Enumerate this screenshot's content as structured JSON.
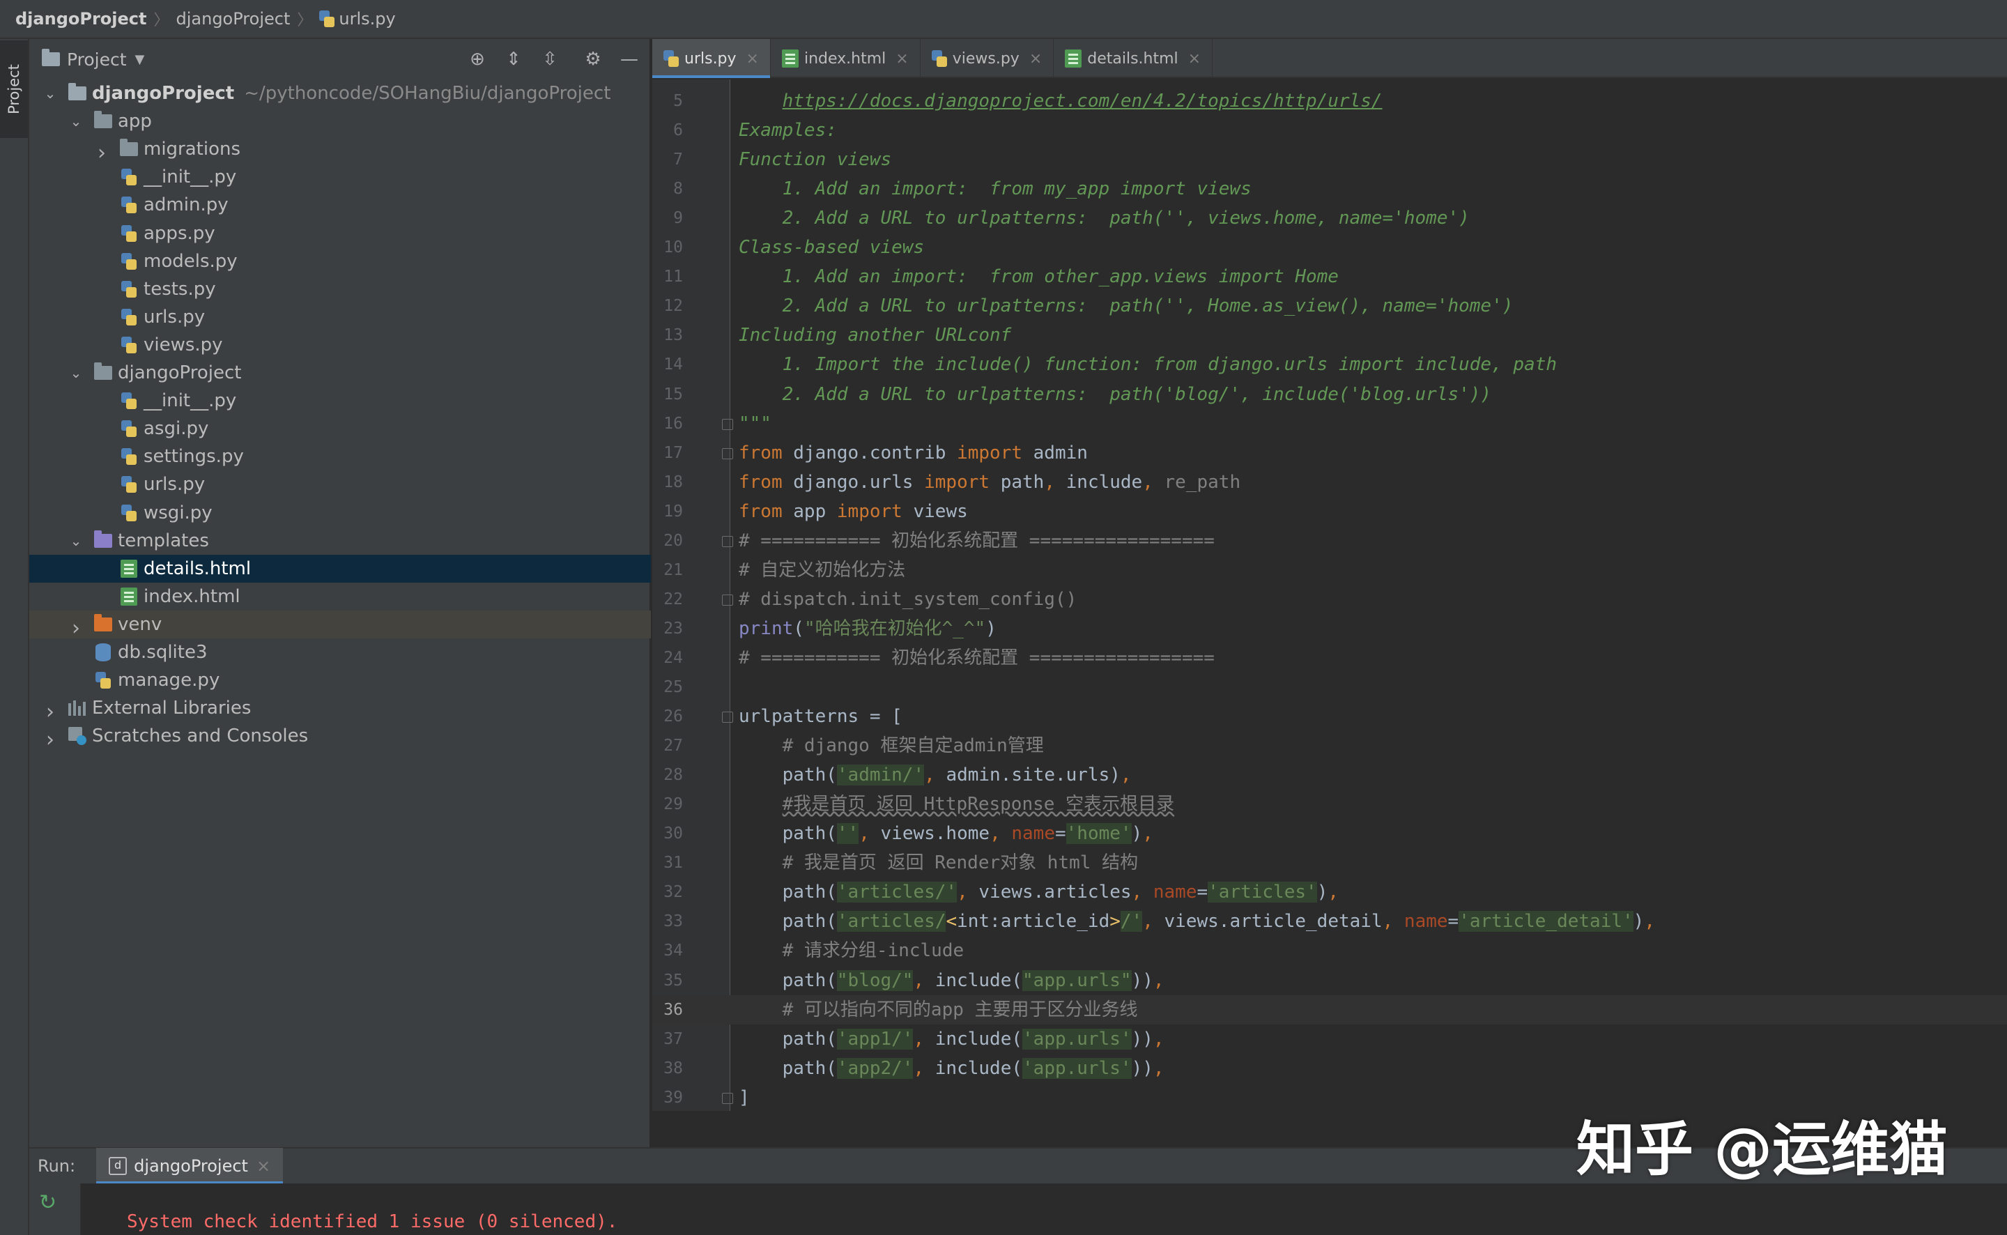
{
  "breadcrumb": [
    "djangoProject",
    "djangoProject",
    "urls.py"
  ],
  "stripe": {
    "project_label": "Project"
  },
  "project_panel": {
    "title": "Project",
    "icons": [
      "locate-icon",
      "expand-all-icon",
      "collapse-all-icon",
      "settings-gear-icon",
      "hide-minus-icon"
    ],
    "tree": [
      {
        "label": "djangoProject",
        "path": "~/pythoncode/SOHangBiu/djangoProject",
        "type": "root",
        "depth": 0,
        "expanded": true
      },
      {
        "label": "app",
        "type": "folder",
        "depth": 1,
        "expanded": true
      },
      {
        "label": "migrations",
        "type": "folder",
        "depth": 2,
        "expanded": false
      },
      {
        "label": "__init__.py",
        "type": "py",
        "depth": 2
      },
      {
        "label": "admin.py",
        "type": "py",
        "depth": 2
      },
      {
        "label": "apps.py",
        "type": "py",
        "depth": 2
      },
      {
        "label": "models.py",
        "type": "py",
        "depth": 2
      },
      {
        "label": "tests.py",
        "type": "py",
        "depth": 2
      },
      {
        "label": "urls.py",
        "type": "py",
        "depth": 2
      },
      {
        "label": "views.py",
        "type": "py",
        "depth": 2
      },
      {
        "label": "djangoProject",
        "type": "folder",
        "depth": 1,
        "expanded": true
      },
      {
        "label": "__init__.py",
        "type": "py",
        "depth": 2
      },
      {
        "label": "asgi.py",
        "type": "py",
        "depth": 2
      },
      {
        "label": "settings.py",
        "type": "py",
        "depth": 2
      },
      {
        "label": "urls.py",
        "type": "py",
        "depth": 2
      },
      {
        "label": "wsgi.py",
        "type": "py",
        "depth": 2
      },
      {
        "label": "templates",
        "type": "folder-purple",
        "depth": 1,
        "expanded": true
      },
      {
        "label": "details.html",
        "type": "html",
        "depth": 2,
        "selected": true
      },
      {
        "label": "index.html",
        "type": "html",
        "depth": 2
      },
      {
        "label": "venv",
        "type": "folder-orange",
        "depth": 1,
        "expanded": false,
        "highlight": true
      },
      {
        "label": "db.sqlite3",
        "type": "db",
        "depth": 1
      },
      {
        "label": "manage.py",
        "type": "py",
        "depth": 1
      },
      {
        "label": "External Libraries",
        "type": "lib",
        "depth": 0,
        "expanded": false
      },
      {
        "label": "Scratches and Consoles",
        "type": "scratch",
        "depth": 0,
        "expanded": false
      }
    ]
  },
  "editor_tabs": [
    {
      "label": "urls.py",
      "type": "py",
      "active": true
    },
    {
      "label": "index.html",
      "type": "html",
      "active": false
    },
    {
      "label": "views.py",
      "type": "py",
      "active": false
    },
    {
      "label": "details.html",
      "type": "html",
      "active": false
    }
  ],
  "editor": {
    "current_line": 36,
    "lines": [
      {
        "n": "5",
        "tokens": [
          [
            "    ",
            "c-doc"
          ],
          [
            "https://docs.djangoproject.com/en/4.2/topics/http/urls/",
            "c-link"
          ]
        ]
      },
      {
        "n": "6",
        "tokens": [
          [
            "Examples:",
            "c-doc"
          ]
        ]
      },
      {
        "n": "7",
        "tokens": [
          [
            "Function views",
            "c-doc"
          ]
        ]
      },
      {
        "n": "8",
        "tokens": [
          [
            "    1. Add an import:  from my_app import views",
            "c-doc"
          ]
        ]
      },
      {
        "n": "9",
        "tokens": [
          [
            "    2. Add a URL to urlpatterns:  path('', views.home, name='home')",
            "c-doc"
          ]
        ]
      },
      {
        "n": "10",
        "tokens": [
          [
            "Class-based views",
            "c-doc"
          ]
        ]
      },
      {
        "n": "11",
        "tokens": [
          [
            "    1. Add an import:  from other_app.views import Home",
            "c-doc"
          ]
        ]
      },
      {
        "n": "12",
        "tokens": [
          [
            "    2. Add a URL to urlpatterns:  path('', Home.as_view(), name='home')",
            "c-doc"
          ]
        ]
      },
      {
        "n": "13",
        "tokens": [
          [
            "Including another URLconf",
            "c-doc"
          ]
        ]
      },
      {
        "n": "14",
        "tokens": [
          [
            "    1. Import the include() function: from django.urls import include, path",
            "c-doc"
          ]
        ]
      },
      {
        "n": "15",
        "tokens": [
          [
            "    2. Add a URL to urlpatterns:  path('blog/', include('blog.urls'))",
            "c-doc"
          ]
        ]
      },
      {
        "n": "16",
        "tokens": [
          [
            "\"\"\"",
            "c-doc"
          ]
        ]
      },
      {
        "n": "17",
        "tokens": [
          [
            "from",
            "c-kw"
          ],
          [
            " django.contrib ",
            "c-plain"
          ],
          [
            "import",
            "c-kw"
          ],
          [
            " admin",
            "c-plain"
          ]
        ]
      },
      {
        "n": "18",
        "tokens": [
          [
            "from",
            "c-kw"
          ],
          [
            " django.urls ",
            "c-plain"
          ],
          [
            "import",
            "c-kw"
          ],
          [
            " path",
            "c-plain"
          ],
          [
            ", ",
            "c-kw"
          ],
          [
            "include",
            "c-plain"
          ],
          [
            ", ",
            "c-kw"
          ],
          [
            "re_path",
            "c-dim"
          ]
        ]
      },
      {
        "n": "19",
        "tokens": [
          [
            "from",
            "c-kw"
          ],
          [
            " app ",
            "c-plain"
          ],
          [
            "import",
            "c-kw"
          ],
          [
            " views",
            "c-plain"
          ]
        ]
      },
      {
        "n": "20",
        "tokens": [
          [
            "# =========== 初始化系统配置 =================",
            "c-cm"
          ]
        ]
      },
      {
        "n": "21",
        "tokens": [
          [
            "# 自定义初始化方法",
            "c-cm"
          ]
        ]
      },
      {
        "n": "22",
        "tokens": [
          [
            "# dispatch.init_system_config()",
            "c-cm"
          ]
        ]
      },
      {
        "n": "23",
        "tokens": [
          [
            "print",
            "c-fn"
          ],
          [
            "(",
            "c-plain"
          ],
          [
            "\"哈哈我在初始化^_^\"",
            "c-str"
          ],
          [
            ")",
            "c-plain"
          ]
        ]
      },
      {
        "n": "24",
        "tokens": [
          [
            "# =========== 初始化系统配置 =================",
            "c-cm"
          ]
        ]
      },
      {
        "n": "25",
        "tokens": []
      },
      {
        "n": "26",
        "tokens": [
          [
            "urlpatterns = [",
            "c-plain"
          ]
        ]
      },
      {
        "n": "27",
        "tokens": [
          [
            "    # django 框架自定admin管理",
            "c-cm"
          ]
        ]
      },
      {
        "n": "28",
        "tokens": [
          [
            "    path(",
            "c-plain"
          ],
          [
            "'admin/'",
            "c-str"
          ],
          [
            ", ",
            "c-kw"
          ],
          [
            "admin.site.urls)",
            "c-plain"
          ],
          [
            ",",
            "c-kw"
          ]
        ]
      },
      {
        "n": "29",
        "tokens": [
          [
            "    ",
            "c-plain"
          ],
          [
            "#我是首页 返回 HttpResponse 空表示根目录",
            "c-cm"
          ]
        ]
      },
      {
        "n": "30",
        "tokens": [
          [
            "    path(",
            "c-plain"
          ],
          [
            "''",
            "c-str"
          ],
          [
            ", ",
            "c-kw"
          ],
          [
            "views.home",
            "c-plain"
          ],
          [
            ", ",
            "c-kw"
          ],
          [
            "name",
            "c-kwarg"
          ],
          [
            "=",
            "c-plain"
          ],
          [
            "'home'",
            "c-str"
          ],
          [
            ")",
            "c-plain"
          ],
          [
            ",",
            "c-kw"
          ]
        ]
      },
      {
        "n": "31",
        "tokens": [
          [
            "    # 我是首页 返回 Render对象 html 结构",
            "c-cm"
          ]
        ]
      },
      {
        "n": "32",
        "tokens": [
          [
            "    path(",
            "c-plain"
          ],
          [
            "'articles/'",
            "c-str"
          ],
          [
            ", ",
            "c-kw"
          ],
          [
            "views.articles",
            "c-plain"
          ],
          [
            ", ",
            "c-kw"
          ],
          [
            "name",
            "c-kwarg"
          ],
          [
            "=",
            "c-plain"
          ],
          [
            "'articles'",
            "c-str"
          ],
          [
            ")",
            "c-plain"
          ],
          [
            ",",
            "c-kw"
          ]
        ]
      },
      {
        "n": "33",
        "tokens": [
          [
            "    path(",
            "c-plain"
          ],
          [
            "'articles/",
            "c-str"
          ],
          [
            "<",
            "c-angle"
          ],
          [
            "int:article_id",
            "c-plain"
          ],
          [
            ">",
            "c-angle"
          ],
          [
            "/'",
            "c-str"
          ],
          [
            ", ",
            "c-kw"
          ],
          [
            "views.article_detail",
            "c-plain"
          ],
          [
            ", ",
            "c-kw"
          ],
          [
            "name",
            "c-kwarg"
          ],
          [
            "=",
            "c-plain"
          ],
          [
            "'article_detail'",
            "c-str"
          ],
          [
            ")",
            "c-plain"
          ],
          [
            ",",
            "c-kw"
          ]
        ]
      },
      {
        "n": "34",
        "tokens": [
          [
            "    # 请求分组-include",
            "c-cm"
          ]
        ]
      },
      {
        "n": "35",
        "tokens": [
          [
            "    path(",
            "c-plain"
          ],
          [
            "\"blog/\"",
            "c-str"
          ],
          [
            ", ",
            "c-kw"
          ],
          [
            "include(",
            "c-plain"
          ],
          [
            "\"app.urls\"",
            "c-str"
          ],
          [
            "))",
            "c-plain"
          ],
          [
            ",",
            "c-kw"
          ]
        ]
      },
      {
        "n": "36",
        "tokens": [
          [
            "    # 可以指向不同的app 主要用于区分业务线",
            "c-cm"
          ]
        ]
      },
      {
        "n": "37",
        "tokens": [
          [
            "    path(",
            "c-plain"
          ],
          [
            "'app1/'",
            "c-str"
          ],
          [
            ", ",
            "c-kw"
          ],
          [
            "include(",
            "c-plain"
          ],
          [
            "'app.urls'",
            "c-str"
          ],
          [
            "))",
            "c-plain"
          ],
          [
            ",",
            "c-kw"
          ]
        ]
      },
      {
        "n": "38",
        "tokens": [
          [
            "    path(",
            "c-plain"
          ],
          [
            "'app2/'",
            "c-str"
          ],
          [
            ", ",
            "c-kw"
          ],
          [
            "include(",
            "c-plain"
          ],
          [
            "'app.urls'",
            "c-str"
          ],
          [
            "))",
            "c-plain"
          ],
          [
            ",",
            "c-kw"
          ]
        ]
      },
      {
        "n": "39",
        "tokens": [
          [
            "]",
            "c-plain"
          ]
        ]
      }
    ]
  },
  "run_panel": {
    "label": "Run:",
    "tab_label": "djangoProject",
    "output": "System check identified 1 issue (0 silenced)."
  },
  "watermark": "知乎 @运维猫",
  "colors": {
    "background": "#2b2b2b",
    "panel": "#3c3f41",
    "selection": "#0d293e",
    "accent": "#4a88c7",
    "keyword": "#cc7832",
    "string": "#6a8759",
    "comment": "#808080",
    "docstring": "#629755"
  }
}
